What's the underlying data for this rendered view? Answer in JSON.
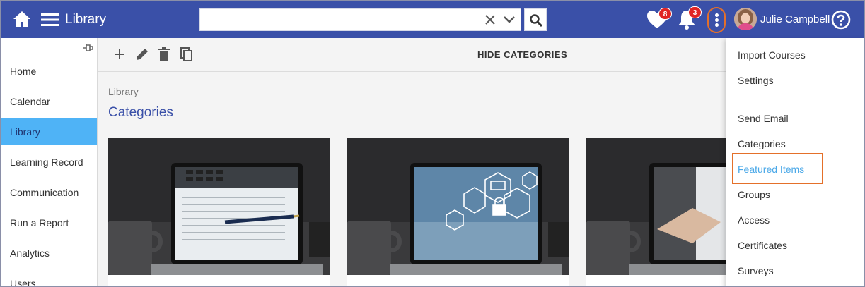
{
  "header": {
    "app_title": "Library",
    "search": {
      "value": "",
      "placeholder": ""
    },
    "favorites": {
      "icon": "heart-icon",
      "count": "8"
    },
    "notifications": {
      "icon": "bell-icon",
      "count": "3"
    },
    "more_icon": "vertical-dots-icon",
    "user_name": "Julie Campbell",
    "help_icon": "question-circle-icon",
    "bar_color": "#3a50a8",
    "badge_color": "#e02424"
  },
  "sidebar": {
    "items": [
      {
        "label": "Home"
      },
      {
        "label": "Calendar"
      },
      {
        "label": "Library",
        "active": true
      },
      {
        "label": "Learning Record"
      },
      {
        "label": "Communication"
      },
      {
        "label": "Run a Report"
      },
      {
        "label": "Analytics"
      },
      {
        "label": "Users"
      }
    ],
    "active_color": "#4fb3f6"
  },
  "toolbar": {
    "tools": [
      "plus-icon",
      "pencil-icon",
      "trash-icon",
      "copy-icon"
    ],
    "hide_categories_label": "HIDE CATEGORIES"
  },
  "main": {
    "breadcrumb": "Library",
    "title": "Categories",
    "cards": [
      {
        "image": "laptop-calculator-financial-charts"
      },
      {
        "image": "laptop-cybersecurity-icons"
      },
      {
        "image": "laptop-handshake"
      }
    ]
  },
  "menu": {
    "items": [
      {
        "label": "Import Courses"
      },
      {
        "label": "Settings"
      },
      {
        "label": "Send Email"
      },
      {
        "label": "Categories"
      },
      {
        "label": "Featured Items",
        "highlighted": true
      },
      {
        "label": "Groups"
      },
      {
        "label": "Access"
      },
      {
        "label": "Certificates"
      },
      {
        "label": "Surveys"
      }
    ],
    "highlight_color": "#e4702a"
  }
}
